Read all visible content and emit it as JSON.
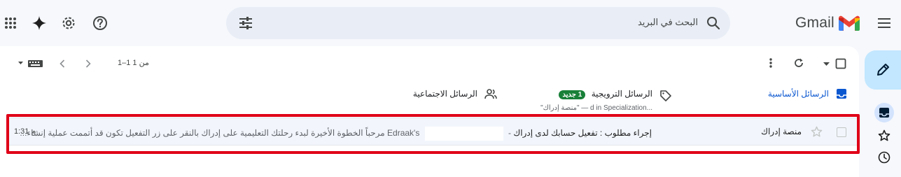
{
  "header": {
    "logo_text": "Gmail",
    "search_placeholder": "البحث في البريد",
    "icons": [
      "menu-icon",
      "gmail-logo",
      "search-icon",
      "search-options-icon",
      "help-icon",
      "settings-icon",
      "gemini-icon",
      "apps-icon"
    ]
  },
  "toolbar": {
    "pager_text": "1–1 من 1"
  },
  "tabs": [
    {
      "label": "الرسائل الأساسية",
      "active": true
    },
    {
      "label": "الرسائل الترويجية",
      "badge": "1 جديد",
      "subtext": "\"منصة إدراك\" — d in Specialization..."
    },
    {
      "label": "الرسائل الاجتماعية"
    }
  ],
  "email": {
    "sender": "منصة إدراك",
    "subject": "إجراء مطلوب : تفعيل حسابك لدى إدراك",
    "separator": "-",
    "preview_brand": "Edraak's",
    "preview": "مرحباً الخطوة الأخيرة لبدء رحلتك التعليمية على إدراك بالنقر على زر التفعيل تكون قد أتممت عملية إنشاء...",
    "time": "1:31 م"
  },
  "colors": {
    "accent": "#0b57d0",
    "compose": "#c2e7ff",
    "badge": "#188038",
    "highlight": "#e00018"
  }
}
